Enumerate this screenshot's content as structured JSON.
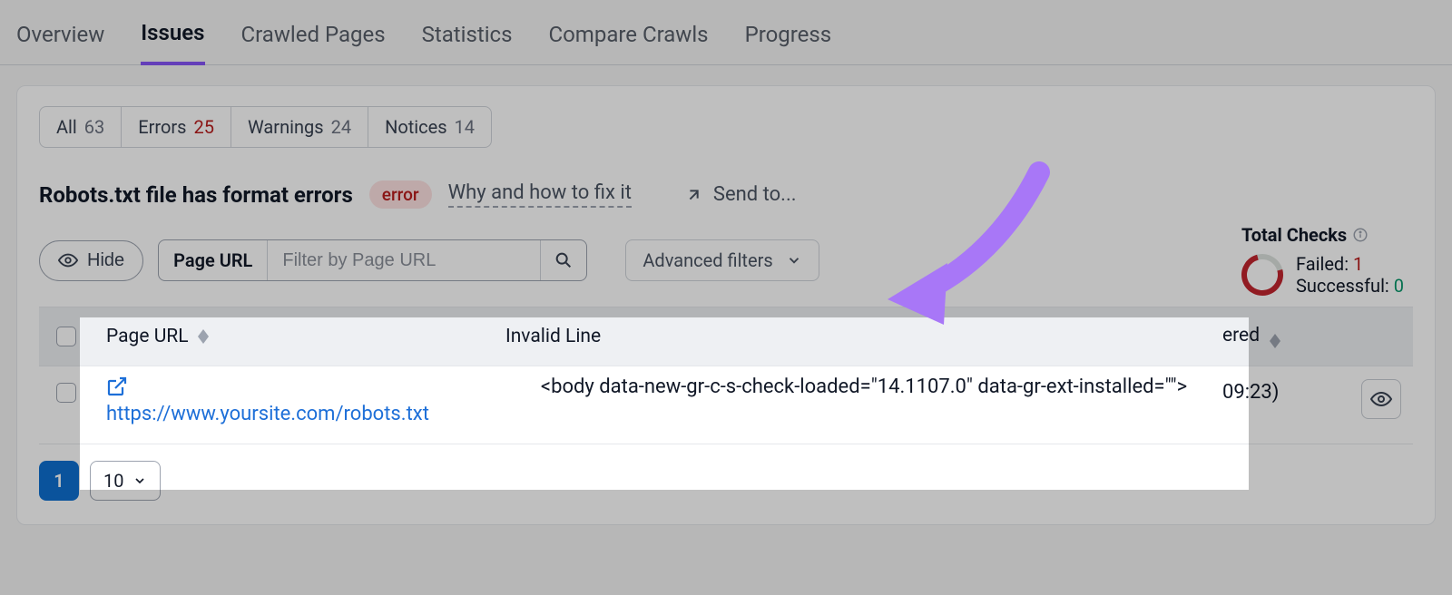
{
  "tabs": {
    "overview": "Overview",
    "issues": "Issues",
    "crawled": "Crawled Pages",
    "statistics": "Statistics",
    "compare": "Compare Crawls",
    "progress": "Progress"
  },
  "pills": {
    "all_label": "All",
    "all_count": "63",
    "errors_label": "Errors",
    "errors_count": "25",
    "warnings_label": "Warnings",
    "warnings_count": "24",
    "notices_label": "Notices",
    "notices_count": "14"
  },
  "issue": {
    "title": "Robots.txt file has format errors",
    "badge": "error",
    "why": "Why and how to fix it",
    "send": "Send to..."
  },
  "filters": {
    "hide_label": "Hide",
    "segment_label": "Page URL",
    "segment_placeholder": "Filter by Page URL",
    "advanced": "Advanced filters"
  },
  "stats": {
    "title": "Total Checks",
    "failed_label": "Failed:",
    "failed_value": "1",
    "success_label": "Successful:",
    "success_value": "0"
  },
  "table": {
    "col_url": "Page URL",
    "col_invalid": "Invalid Line",
    "col_time_fragment": "ered",
    "row_url": "https://www.yoursite.com/robots.txt",
    "row_invalid": "<body data-new-gr-c-s-check-loaded=\"14.1107.0\" data-gr-ext-installed=\"\">",
    "row_time_fragment": "09:23)"
  },
  "pagination": {
    "current": "1",
    "page_size": "10"
  }
}
